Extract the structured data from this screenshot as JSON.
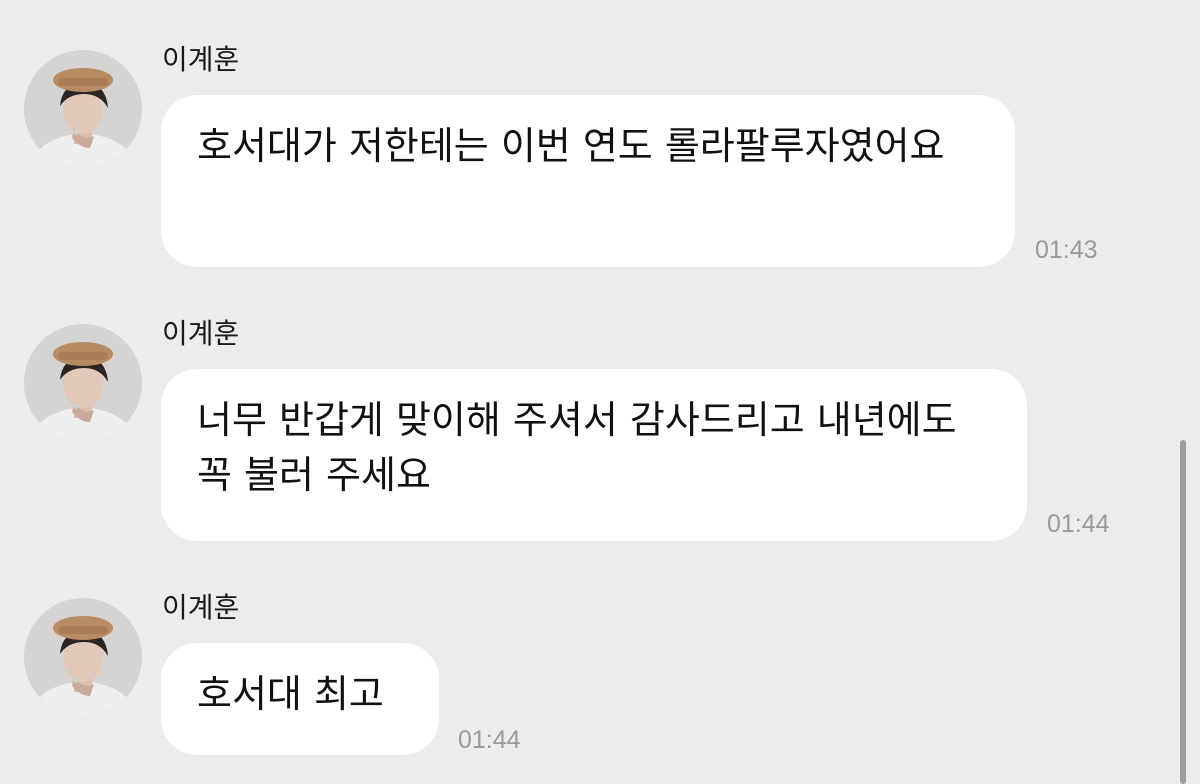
{
  "messages": [
    {
      "sender": "이계훈",
      "text": "호서대가 저한테는 이번 연도 롤라팔루자였어요",
      "time": "01:43"
    },
    {
      "sender": "이계훈",
      "text": "너무 반갑게 맞이해 주셔서 감사드리고 내년에도 꼭 불러 주세요",
      "time": "01:44"
    },
    {
      "sender": "이계훈",
      "text": "호서대 최고",
      "time": "01:44"
    }
  ],
  "colors": {
    "background": "#ececed",
    "bubble": "#ffffff",
    "timestamp": "#9a9a9c"
  }
}
